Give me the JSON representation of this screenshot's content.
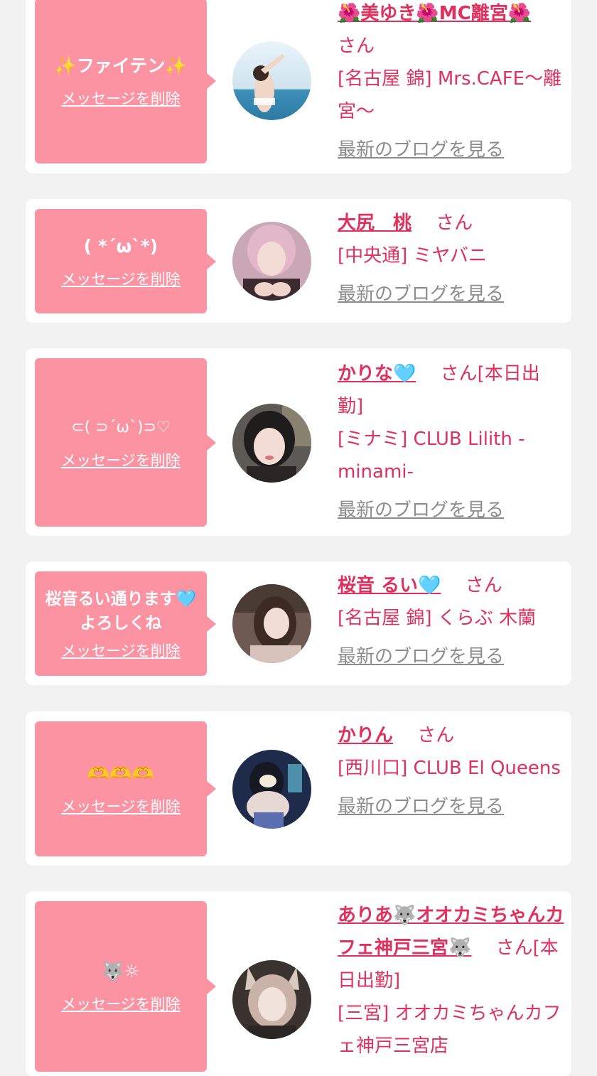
{
  "colors": {
    "page_background": "#f2f2f2",
    "card_background": "#ffffff",
    "bubble": "#fc93a3",
    "name_text": "#e0305e",
    "blog_link": "#8c8c8c"
  },
  "common": {
    "delete_label": "メッセージを削除",
    "san_label": "さん",
    "blog_label": "最新のブログを見る"
  },
  "entries": [
    {
      "message": "✨ファイテン✨",
      "name": "🌺美ゆき🌺MC離宮🌺",
      "san": "さん",
      "shop": "[名古屋 錦] Mrs.CAFE〜離宮〜"
    },
    {
      "message": "( *´ω`*)",
      "name": "大尻　桃",
      "san": "さん",
      "shop": "[中央通] ミヤバニ"
    },
    {
      "message": "⊂( ⊃´ω`)⊃♡",
      "name": "かりな🩵",
      "san": "さん[本日出勤]",
      "shop": "[ミナミ] CLUB Lilith -minami-"
    },
    {
      "message": "桜音るい通ります🩵よろしくね",
      "name": "桜音 るい🩵",
      "san": "さん",
      "shop": "[名古屋 錦] くらぶ 木蘭"
    },
    {
      "message": "🫶🫶🫶",
      "name": "かりん",
      "san": "さん",
      "shop": "[西川口] CLUB El Queens"
    },
    {
      "message": "🐺☼",
      "name": "ありあ🐺オオカミちゃんカフェ神戸三宮🐺",
      "san": "さん[本日出勤]",
      "shop": "[三宮] オオカミちゃんカフェ神戸三宮店"
    }
  ]
}
